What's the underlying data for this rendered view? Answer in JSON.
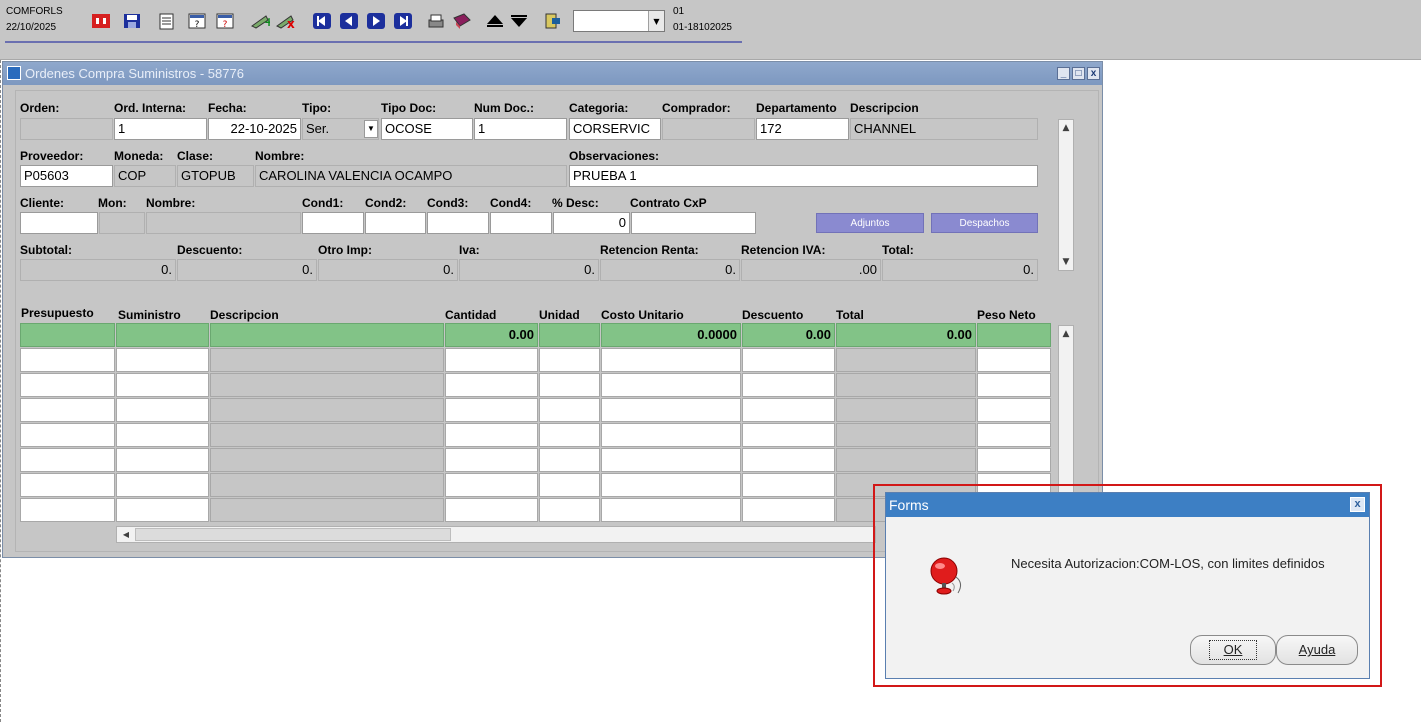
{
  "topbar": {
    "form_name": "COMFORLS",
    "date": "22/10/2025",
    "session_line1": "01",
    "session_line2": "01-18102025",
    "combo_value": "",
    "icons": [
      "exit-icon",
      "save-icon",
      "clear-form-icon",
      "enter-query-icon",
      "execute-query-icon",
      "insert-record-icon",
      "delete-record-icon",
      "first-record-icon",
      "previous-record-icon",
      "next-record-icon",
      "last-record-icon",
      "print-icon",
      "help-icon",
      "previous-block-icon",
      "next-block-icon",
      "list-values-icon"
    ]
  },
  "window": {
    "title": "Ordenes Compra Suministros - 58776"
  },
  "header": {
    "labels": {
      "orden": "Orden:",
      "ord_interna": "Ord. Interna:",
      "fecha": "Fecha:",
      "tipo": "Tipo:",
      "tipo_doc": "Tipo Doc:",
      "num_doc": "Num Doc.:",
      "categoria": "Categoria:",
      "comprador": "Comprador:",
      "departamento": "Departamento",
      "descripcion": "Descripcion",
      "proveedor": "Proveedor:",
      "moneda": "Moneda:",
      "clase": "Clase:",
      "nombre": "Nombre:",
      "observaciones": "Observaciones:",
      "cliente": "Cliente:",
      "mon": "Mon:",
      "nombre2": "Nombre:",
      "cond1": "Cond1:",
      "cond2": "Cond2:",
      "cond3": "Cond3:",
      "cond4": "Cond4:",
      "pct_desc": "% Desc:",
      "contrato": "Contrato CxP",
      "subtotal": "Subtotal:",
      "descuento": "Descuento:",
      "otro_imp": "Otro Imp:",
      "iva": "Iva:",
      "ret_renta": "Retencion Renta:",
      "ret_iva": "Retencion IVA:",
      "total": "Total:"
    },
    "values": {
      "orden": "",
      "ord_interna": "1",
      "fecha": "22-10-2025",
      "tipo": "Ser.",
      "tipo_doc": "OCOSE",
      "num_doc": "1",
      "categoria": "CORSERVIC",
      "comprador": "",
      "departamento": "172",
      "descripcion": "CHANNEL",
      "proveedor": "P05603",
      "moneda": "COP",
      "clase": "GTOPUB",
      "nombre": "CAROLINA VALENCIA OCAMPO",
      "observaciones": "PRUEBA 1",
      "pct_desc": "0",
      "subtotal": "0.",
      "descuento": "0.",
      "otro_imp": "0.",
      "iva": "0.",
      "ret_renta": "0.",
      "ret_iva": ".00",
      "total": "0."
    },
    "buttons": {
      "adjuntos": "Adjuntos",
      "despachos": "Despachos"
    }
  },
  "grid": {
    "columns": [
      "Presupuesto",
      "Suministro",
      "Descripcion",
      "Cantidad",
      "Unidad",
      "Costo Unitario",
      "Descuento",
      "Total",
      "Peso Neto"
    ],
    "first_row": {
      "cantidad": "0.00",
      "costo_unitario": "0.0000",
      "descuento": "0.00",
      "total": "0.00"
    }
  },
  "dialog": {
    "title": "Forms",
    "message": "Necesita Autorizacion:COM-LOS, con limites definidos",
    "ok_label": "OK",
    "help_label": "Ayuda",
    "icon": "alarm-bell-icon"
  }
}
